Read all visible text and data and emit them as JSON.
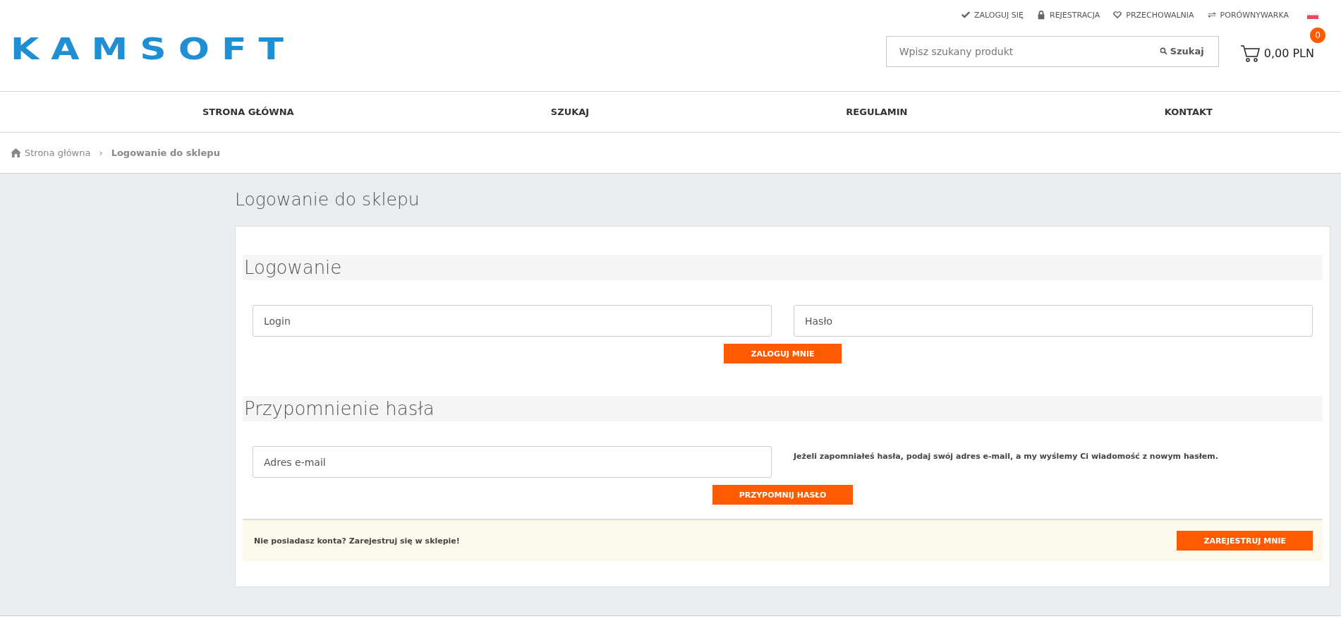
{
  "top_links": [
    {
      "kind": "check",
      "label": "ZALOGUJ SIĘ"
    },
    {
      "kind": "lock",
      "label": "REJESTRACJA"
    },
    {
      "kind": "heart",
      "label": "PRZECHOWALNIA"
    },
    {
      "kind": "swap",
      "label": "PORÓWNYWARKA"
    }
  ],
  "logo": "KAMSOFT",
  "search": {
    "placeholder": "Wpisz szukany produkt",
    "button": "Szukaj"
  },
  "cart": {
    "count": "0",
    "total": "0,00 PLN"
  },
  "nav": [
    "STRONA GŁÓWNA",
    "SZUKAJ",
    "REGULAMIN",
    "KONTAKT"
  ],
  "breadcrumb": [
    "Strona główna",
    "›",
    "Logowanie do sklepu"
  ],
  "page_title": "Logowanie do sklepu",
  "login": {
    "heading": "Logowanie",
    "fields": [
      {
        "placeholder": "Login"
      },
      {
        "placeholder": "Hasło"
      }
    ],
    "button": "ZALOGUJ MNIE"
  },
  "reminder": {
    "heading": "Przypomnienie hasła",
    "field": {
      "placeholder": "Adres e-mail"
    },
    "note": "Jeżeli zapomniałeś hasła, podaj swój adres e-mail, a my wyślemy Ci wiadomość z nowym hasłem.",
    "button": "PRZYPOMNIJ HASŁO"
  },
  "register": {
    "text": "Nie posiadasz konta? Zarejestruj się w sklepie!",
    "button": "ZAREJESTRUJ MNIE"
  }
}
